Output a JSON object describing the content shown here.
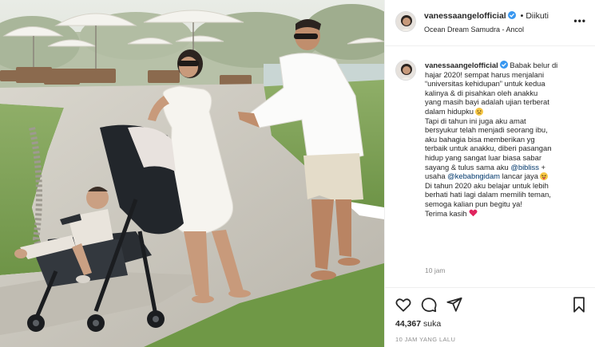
{
  "post": {
    "username": "vanessaangelofficial",
    "follow_separator": "•",
    "follow_status": "Diikuti",
    "location": "Ocean Dream Samudra - Ancol",
    "caption": {
      "line1": "Babak belur di",
      "line2": "hajar 2020! sempat harus menjalani",
      "line3": "“universitas kehidupan” untuk kedua",
      "line4": "kalinya & di pisahkan oleh anakku",
      "line5": "yang masih bayi adalah ujian terberat",
      "line6": "dalam hidupku",
      "line7": "Tapi di tahun ini juga aku amat",
      "line8": "bersyukur telah menjadi seorang ibu,",
      "line9": "aku bahagia bisa memberikan yg",
      "line10": "terbaik untuk anakku, diberi pasangan",
      "line11": "hidup yang sangat luar biasa sabar",
      "line12a": "sayang & tulus sama aku ",
      "line12b": "@bibliss",
      "line12c": " +",
      "line13a": "usaha ",
      "line13b": "@kebabngidam",
      "line13c": " lancar jaya",
      "line14": "Di tahun 2020 aku belajar untuk lebih",
      "line15": "berhati hati lagi dalam memilih teman,",
      "line16": "semoga kalian pun begitu ya!",
      "line17": "Terima kasih"
    },
    "post_time": "10 jam",
    "likes_count": "44,367",
    "likes_label": "suka",
    "time_ago": "10 JAM YANG LALU",
    "icons": {
      "like": "heart-outline-icon",
      "comment": "comment-icon",
      "share": "send-icon",
      "save": "bookmark-icon",
      "more": "more-options-icon",
      "verified": "verified-badge-icon"
    },
    "colors": {
      "verified": "#3897f0",
      "mention": "#00376b",
      "heart_emoji": "#e0245e"
    }
  }
}
